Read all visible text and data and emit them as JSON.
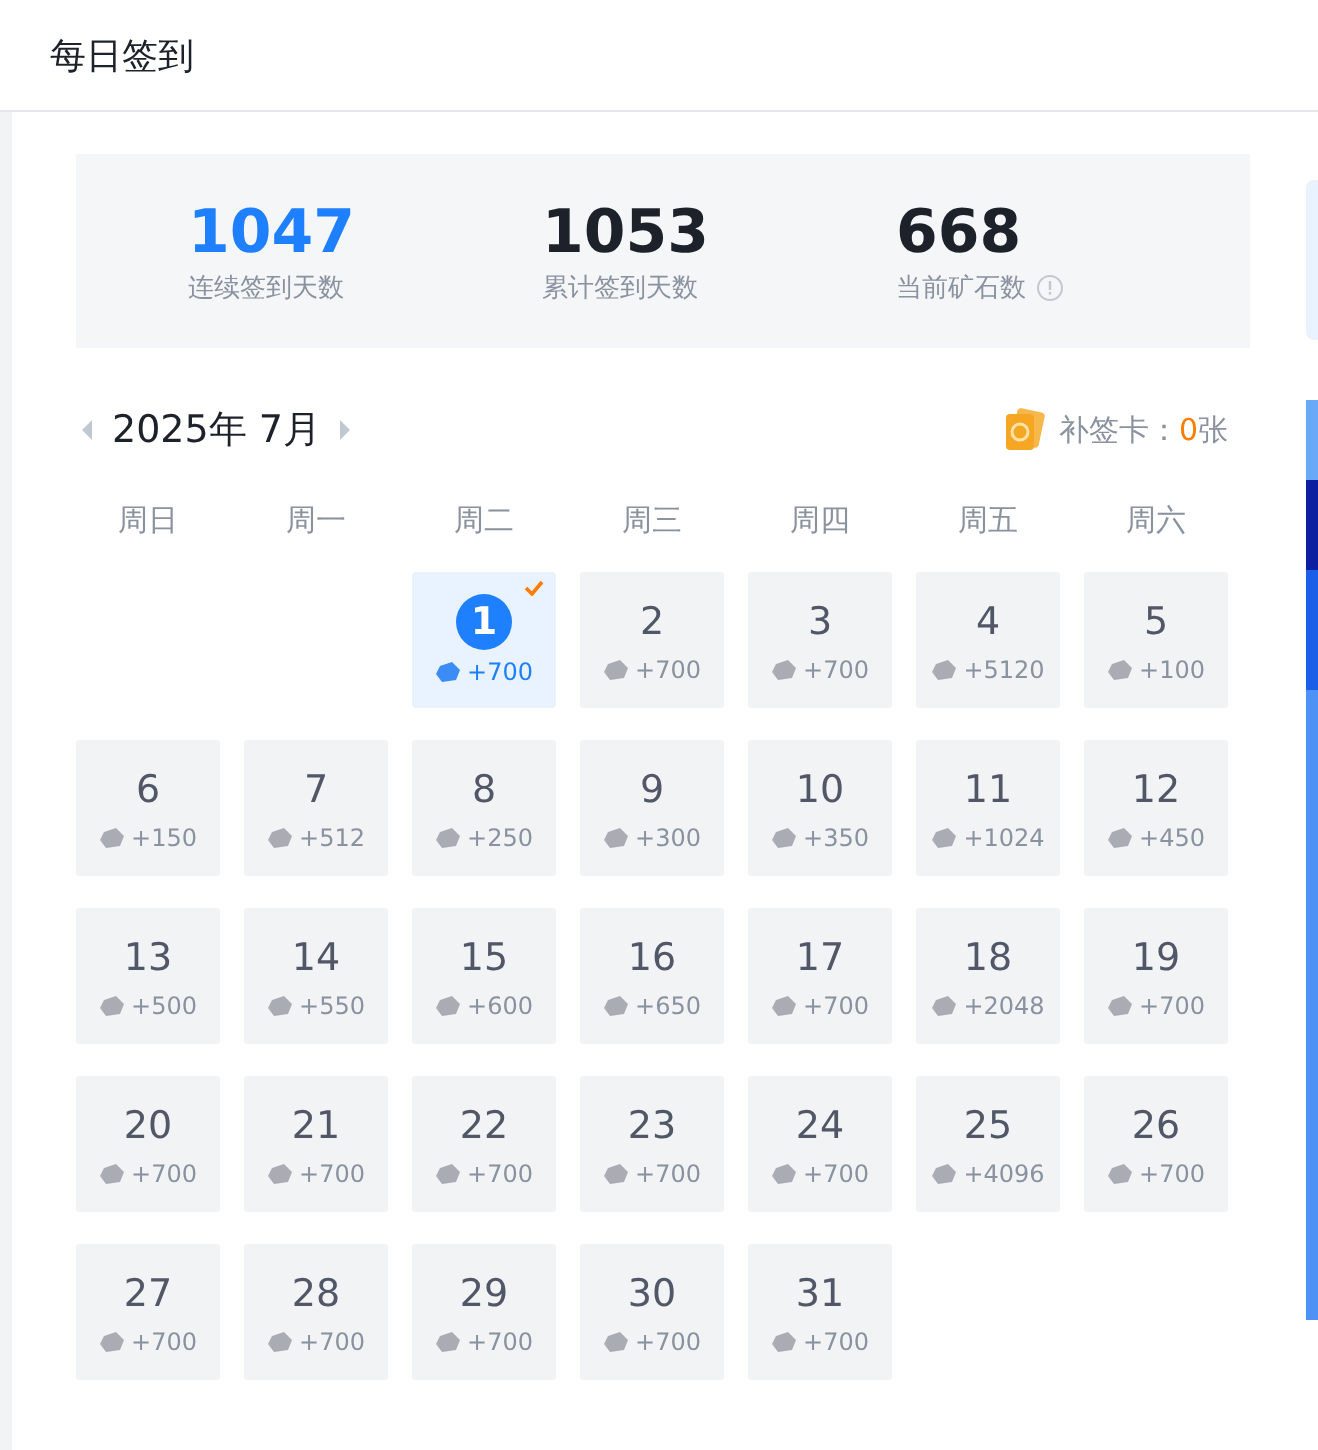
{
  "header": {
    "title": "每日签到"
  },
  "stats": [
    {
      "value": "1047",
      "label": "连续签到天数",
      "highlight": true,
      "info": false
    },
    {
      "value": "1053",
      "label": "累计签到天数",
      "highlight": false,
      "info": false
    },
    {
      "value": "668",
      "label": "当前矿石数",
      "highlight": false,
      "info": true
    }
  ],
  "calendar": {
    "month": "2025年 7月",
    "makeup_label": "补签卡：",
    "makeup_count": "0",
    "makeup_unit": "张",
    "weekdays": [
      "周日",
      "周一",
      "周二",
      "周三",
      "周四",
      "周五",
      "周六"
    ],
    "days": [
      {
        "kind": "blank"
      },
      {
        "kind": "blank"
      },
      {
        "kind": "day",
        "day": "1",
        "reward": "+700",
        "signed": true
      },
      {
        "kind": "day",
        "day": "2",
        "reward": "+700",
        "signed": false
      },
      {
        "kind": "day",
        "day": "3",
        "reward": "+700",
        "signed": false
      },
      {
        "kind": "day",
        "day": "4",
        "reward": "+5120",
        "signed": false
      },
      {
        "kind": "day",
        "day": "5",
        "reward": "+100",
        "signed": false
      },
      {
        "kind": "day",
        "day": "6",
        "reward": "+150",
        "signed": false
      },
      {
        "kind": "day",
        "day": "7",
        "reward": "+512",
        "signed": false
      },
      {
        "kind": "day",
        "day": "8",
        "reward": "+250",
        "signed": false
      },
      {
        "kind": "day",
        "day": "9",
        "reward": "+300",
        "signed": false
      },
      {
        "kind": "day",
        "day": "10",
        "reward": "+350",
        "signed": false
      },
      {
        "kind": "day",
        "day": "11",
        "reward": "+1024",
        "signed": false
      },
      {
        "kind": "day",
        "day": "12",
        "reward": "+450",
        "signed": false
      },
      {
        "kind": "day",
        "day": "13",
        "reward": "+500",
        "signed": false
      },
      {
        "kind": "day",
        "day": "14",
        "reward": "+550",
        "signed": false
      },
      {
        "kind": "day",
        "day": "15",
        "reward": "+600",
        "signed": false
      },
      {
        "kind": "day",
        "day": "16",
        "reward": "+650",
        "signed": false
      },
      {
        "kind": "day",
        "day": "17",
        "reward": "+700",
        "signed": false
      },
      {
        "kind": "day",
        "day": "18",
        "reward": "+2048",
        "signed": false
      },
      {
        "kind": "day",
        "day": "19",
        "reward": "+700",
        "signed": false
      },
      {
        "kind": "day",
        "day": "20",
        "reward": "+700",
        "signed": false
      },
      {
        "kind": "day",
        "day": "21",
        "reward": "+700",
        "signed": false
      },
      {
        "kind": "day",
        "day": "22",
        "reward": "+700",
        "signed": false
      },
      {
        "kind": "day",
        "day": "23",
        "reward": "+700",
        "signed": false
      },
      {
        "kind": "day",
        "day": "24",
        "reward": "+700",
        "signed": false
      },
      {
        "kind": "day",
        "day": "25",
        "reward": "+4096",
        "signed": false
      },
      {
        "kind": "day",
        "day": "26",
        "reward": "+700",
        "signed": false
      },
      {
        "kind": "day",
        "day": "27",
        "reward": "+700",
        "signed": false
      },
      {
        "kind": "day",
        "day": "28",
        "reward": "+700",
        "signed": false
      },
      {
        "kind": "day",
        "day": "29",
        "reward": "+700",
        "signed": false
      },
      {
        "kind": "day",
        "day": "30",
        "reward": "+700",
        "signed": false
      },
      {
        "kind": "day",
        "day": "31",
        "reward": "+700",
        "signed": false
      }
    ]
  }
}
